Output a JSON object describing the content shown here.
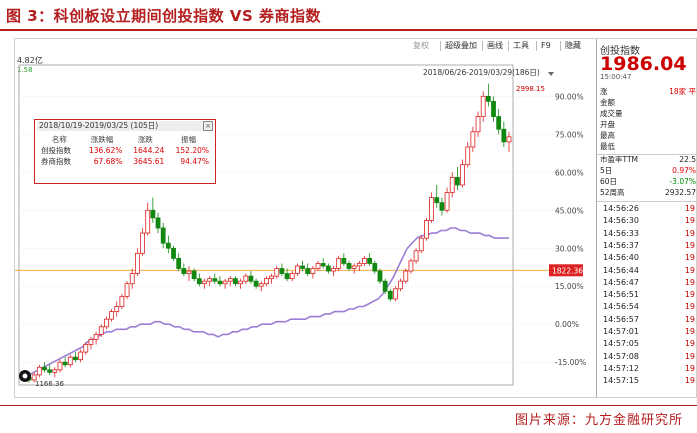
{
  "figure": {
    "title": "图 3：科创板设立期间创投指数 VS 券商指数",
    "source": "图片来源：九方金融研究所"
  },
  "toolbar": {
    "items": [
      {
        "label": "复权",
        "disabled": true
      },
      {
        "label": "超级叠加"
      },
      {
        "label": "画线"
      },
      {
        "label": "工具"
      },
      {
        "label": "F9"
      },
      {
        "label": "隐藏"
      }
    ]
  },
  "chart_header": {
    "value_label": "4.82亿",
    "value_label2": "1.58",
    "date_range": "2018/06/26-2019/03/29(186日)"
  },
  "chart": {
    "y_axis_labels": [
      "90.00%",
      "75.00%",
      "60.00%",
      "45.00%",
      "30.00%",
      "15.00%",
      "0.00%",
      "-15.00%"
    ],
    "y_axis_values": [
      90,
      75,
      60,
      45,
      30,
      15,
      0,
      -15
    ],
    "current_label": "1822.36",
    "high_label": "2998.15",
    "low_label": "1166.36",
    "current_pct": 21.3,
    "colors": {
      "up": "#dd2222",
      "down": "#118811",
      "compare": "#9b7fd4",
      "ref_line": "#f0a030"
    }
  },
  "chart_data": {
    "type": "candlestick",
    "date_range": "2018/06/26-2019/03/29",
    "ylim": [
      -24,
      100
    ],
    "series": [
      {
        "name": "创投指数",
        "style": "candlestick",
        "ohlc": [
          [
            -21,
            -20,
            -23,
            -22
          ],
          [
            -22,
            -19,
            -23,
            -20
          ],
          [
            -20,
            -16,
            -21,
            -17
          ],
          [
            -17,
            -15,
            -19,
            -18
          ],
          [
            -18,
            -16,
            -20,
            -19
          ],
          [
            -19,
            -17,
            -21,
            -18
          ],
          [
            -18,
            -14,
            -19,
            -15
          ],
          [
            -15,
            -13,
            -17,
            -16
          ],
          [
            -16,
            -12,
            -17,
            -13
          ],
          [
            -13,
            -11,
            -15,
            -14
          ],
          [
            -14,
            -10,
            -15,
            -11
          ],
          [
            -11,
            -7,
            -12,
            -8
          ],
          [
            -8,
            -5,
            -10,
            -6
          ],
          [
            -6,
            -3,
            -8,
            -4
          ],
          [
            -4,
            0,
            -5,
            -1
          ],
          [
            -1,
            3,
            -2,
            2
          ],
          [
            2,
            6,
            1,
            5
          ],
          [
            5,
            9,
            3,
            7
          ],
          [
            7,
            12,
            6,
            11
          ],
          [
            11,
            17,
            10,
            16
          ],
          [
            16,
            22,
            14,
            20
          ],
          [
            20,
            30,
            19,
            28
          ],
          [
            28,
            38,
            27,
            36
          ],
          [
            36,
            48,
            35,
            45
          ],
          [
            45,
            50,
            40,
            42
          ],
          [
            42,
            44,
            36,
            38
          ],
          [
            38,
            40,
            30,
            32
          ],
          [
            32,
            35,
            28,
            30
          ],
          [
            30,
            31,
            25,
            26
          ],
          [
            26,
            28,
            21,
            22
          ],
          [
            22,
            24,
            19,
            20
          ],
          [
            20,
            23,
            17,
            21
          ],
          [
            21,
            22,
            17,
            18
          ],
          [
            18,
            20,
            15,
            16
          ],
          [
            16,
            18,
            14,
            17
          ],
          [
            17,
            19,
            15,
            18
          ],
          [
            18,
            20,
            16,
            17
          ],
          [
            17,
            19,
            15,
            16
          ],
          [
            16,
            18,
            14,
            17
          ],
          [
            17,
            19,
            15,
            18
          ],
          [
            18,
            19,
            15,
            16
          ],
          [
            16,
            18,
            14,
            17
          ],
          [
            17,
            20,
            16,
            19
          ],
          [
            19,
            21,
            16,
            17
          ],
          [
            17,
            18,
            14,
            15
          ],
          [
            15,
            17,
            13,
            16
          ],
          [
            16,
            19,
            15,
            18
          ],
          [
            18,
            20,
            16,
            19
          ],
          [
            19,
            23,
            18,
            22
          ],
          [
            22,
            24,
            19,
            20
          ],
          [
            20,
            22,
            17,
            18
          ],
          [
            18,
            21,
            17,
            20
          ],
          [
            20,
            24,
            19,
            23
          ],
          [
            23,
            25,
            21,
            22
          ],
          [
            22,
            24,
            19,
            20
          ],
          [
            20,
            23,
            18,
            22
          ],
          [
            22,
            25,
            21,
            24
          ],
          [
            24,
            26,
            22,
            23
          ],
          [
            23,
            24,
            20,
            21
          ],
          [
            21,
            23,
            19,
            22
          ],
          [
            22,
            27,
            21,
            26
          ],
          [
            26,
            28,
            23,
            24
          ],
          [
            24,
            25,
            21,
            22
          ],
          [
            22,
            24,
            20,
            23
          ],
          [
            23,
            25,
            21,
            24
          ],
          [
            24,
            27,
            23,
            26
          ],
          [
            26,
            28,
            23,
            24
          ],
          [
            24,
            25,
            20,
            21
          ],
          [
            21,
            22,
            16,
            17
          ],
          [
            17,
            18,
            12,
            13
          ],
          [
            13,
            14,
            9,
            10
          ],
          [
            10,
            15,
            9,
            14
          ],
          [
            14,
            18,
            13,
            17
          ],
          [
            17,
            22,
            16,
            21
          ],
          [
            21,
            26,
            20,
            25
          ],
          [
            25,
            30,
            24,
            29
          ],
          [
            29,
            35,
            28,
            34
          ],
          [
            34,
            42,
            33,
            41
          ],
          [
            41,
            52,
            40,
            50
          ],
          [
            50,
            55,
            46,
            48
          ],
          [
            48,
            50,
            43,
            45
          ],
          [
            45,
            54,
            44,
            52
          ],
          [
            52,
            60,
            50,
            58
          ],
          [
            58,
            62,
            53,
            55
          ],
          [
            55,
            65,
            54,
            63
          ],
          [
            63,
            72,
            62,
            70
          ],
          [
            70,
            78,
            68,
            76
          ],
          [
            76,
            84,
            74,
            82
          ],
          [
            82,
            92,
            80,
            90
          ],
          [
            90,
            95,
            86,
            88
          ],
          [
            88,
            90,
            80,
            82
          ],
          [
            82,
            85,
            75,
            77
          ],
          [
            77,
            80,
            70,
            72
          ],
          [
            72,
            76,
            68,
            74
          ]
        ]
      },
      {
        "name": "券商指数",
        "style": "line",
        "values": [
          -20,
          -19,
          -18,
          -17,
          -16,
          -15,
          -14,
          -13,
          -12,
          -11,
          -10,
          -9,
          -7,
          -6,
          -5,
          -4,
          -3,
          -3,
          -2,
          -2,
          -2,
          -1,
          -1,
          0,
          0,
          0,
          1,
          1,
          0,
          0,
          -1,
          -1,
          -2,
          -2,
          -3,
          -3,
          -3,
          -4,
          -4,
          -5,
          -4,
          -4,
          -3,
          -3,
          -2,
          -2,
          -1,
          -1,
          0,
          0,
          0,
          1,
          1,
          1,
          2,
          2,
          2,
          2,
          3,
          3,
          3,
          4,
          4,
          5,
          5,
          5,
          6,
          6,
          7,
          7,
          8,
          9,
          10,
          12,
          15,
          18,
          22,
          26,
          30,
          32,
          34,
          35,
          35,
          36,
          36,
          37,
          37,
          38,
          38,
          37,
          37,
          36,
          36,
          36,
          35,
          35,
          34,
          34,
          34,
          34
        ]
      }
    ],
    "reference_line": 21.3
  },
  "popup": {
    "title": "2018/10/19-2019/03/25 (105日)",
    "headers": [
      "名称",
      "涨跌幅",
      "涨跌",
      "振幅"
    ],
    "rows": [
      [
        "创投指数",
        "136.62%",
        "1644.24",
        "152.20%"
      ],
      [
        "券商指数",
        "67.68%",
        "3645.61",
        "94.47%"
      ]
    ]
  },
  "right_panel": {
    "name": "创投指数",
    "price": "1986.04",
    "time": "15:00:47",
    "stats": [
      {
        "k": "涨",
        "v": "18家  平"
      },
      {
        "k": "金额",
        "v": ""
      },
      {
        "k": "成交量",
        "v": ""
      },
      {
        "k": "开盘",
        "v": ""
      },
      {
        "k": "最高",
        "v": ""
      },
      {
        "k": "最低",
        "v": ""
      }
    ],
    "extras": [
      {
        "k": "市盈率TTM",
        "v": "22.5"
      },
      {
        "k": "5日",
        "v": "0.97%"
      },
      {
        "k": "60日",
        "v": "-3.07%"
      },
      {
        "k": "52周高",
        "v": "2932.57"
      }
    ],
    "ticks": [
      {
        "t": "14:56:26",
        "n": "19"
      },
      {
        "t": "14:56:30",
        "n": "19"
      },
      {
        "t": "14:56:33",
        "n": "19"
      },
      {
        "t": "14:56:37",
        "n": "19"
      },
      {
        "t": "14:56:40",
        "n": "19"
      },
      {
        "t": "14:56:44",
        "n": "19"
      },
      {
        "t": "14:56:47",
        "n": "19"
      },
      {
        "t": "14:56:51",
        "n": "19"
      },
      {
        "t": "14:56:54",
        "n": "19"
      },
      {
        "t": "14:56:57",
        "n": "19"
      },
      {
        "t": "14:57:01",
        "n": "19"
      },
      {
        "t": "14:57:05",
        "n": "19"
      },
      {
        "t": "14:57:08",
        "n": "19"
      },
      {
        "t": "14:57:12",
        "n": "19"
      },
      {
        "t": "14:57:15",
        "n": "19"
      }
    ]
  }
}
